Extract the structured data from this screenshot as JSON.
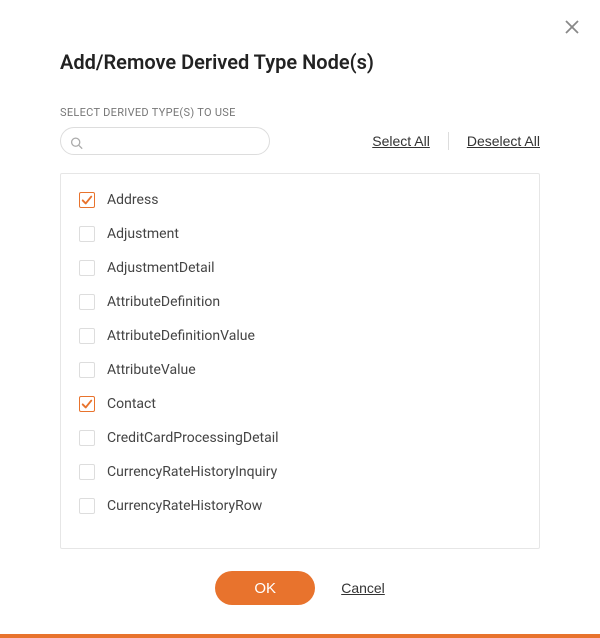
{
  "dialog": {
    "title": "Add/Remove Derived Type Node(s)",
    "field_label": "SELECT DERIVED TYPE(S) TO USE",
    "search_placeholder": "",
    "select_all": "Select All",
    "deselect_all": "Deselect All",
    "ok": "OK",
    "cancel": "Cancel"
  },
  "items": [
    {
      "label": "Address",
      "checked": true
    },
    {
      "label": "Adjustment",
      "checked": false
    },
    {
      "label": "AdjustmentDetail",
      "checked": false
    },
    {
      "label": "AttributeDefinition",
      "checked": false
    },
    {
      "label": "AttributeDefinitionValue",
      "checked": false
    },
    {
      "label": "AttributeValue",
      "checked": false
    },
    {
      "label": "Contact",
      "checked": true
    },
    {
      "label": "CreditCardProcessingDetail",
      "checked": false
    },
    {
      "label": "CurrencyRateHistoryInquiry",
      "checked": false
    },
    {
      "label": "CurrencyRateHistoryRow",
      "checked": false
    }
  ],
  "colors": {
    "accent": "#e8732d"
  }
}
